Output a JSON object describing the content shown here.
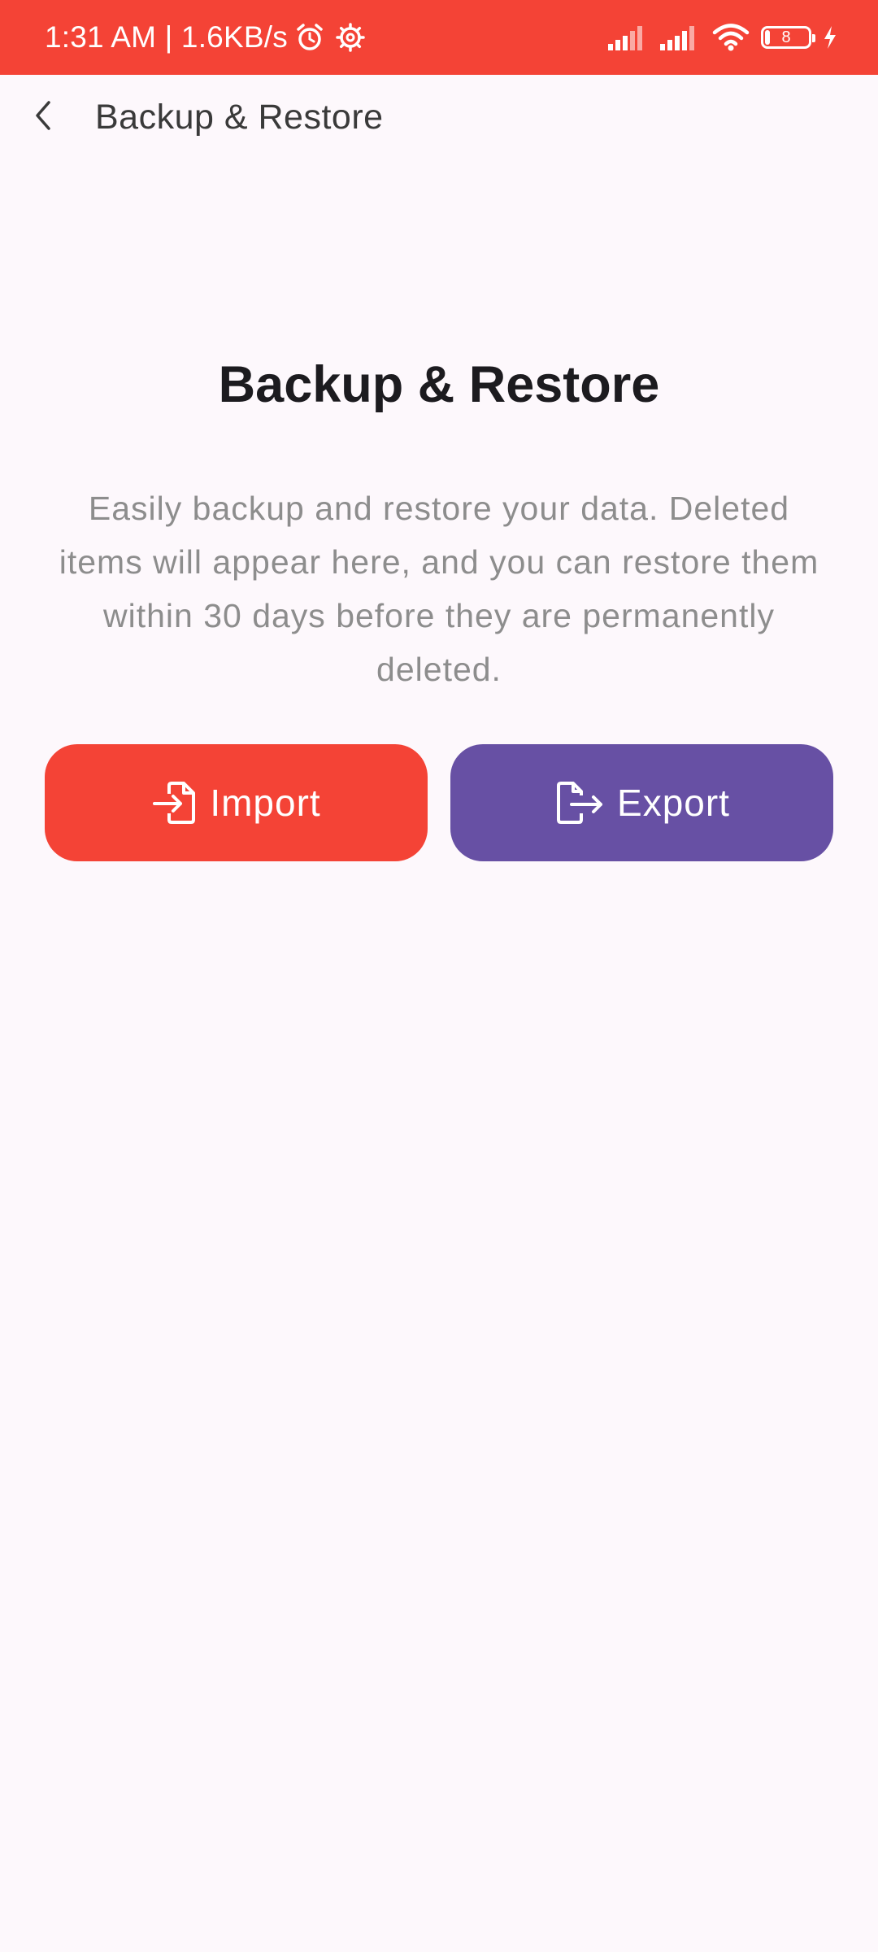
{
  "status_bar": {
    "time_speed": "1:31 AM | 1.6KB/s",
    "icons": [
      "alarm-icon",
      "settings-icon",
      "signal-icon",
      "signal-icon",
      "wifi-icon",
      "battery-icon",
      "charging-icon"
    ],
    "battery_level": "8",
    "background_color": "#f44336"
  },
  "app_bar": {
    "back_icon": "chevron-left-icon",
    "title": "Backup & Restore"
  },
  "main": {
    "headline": "Backup & Restore",
    "description": "Easily backup and restore your data. Deleted items will appear here, and you can restore them within 30 days before they are permanently deleted."
  },
  "buttons": {
    "import": {
      "label": "Import",
      "icon": "file-import-icon",
      "color": "#f44336"
    },
    "export": {
      "label": "Export",
      "icon": "file-export-icon",
      "color": "#6750a4"
    }
  }
}
